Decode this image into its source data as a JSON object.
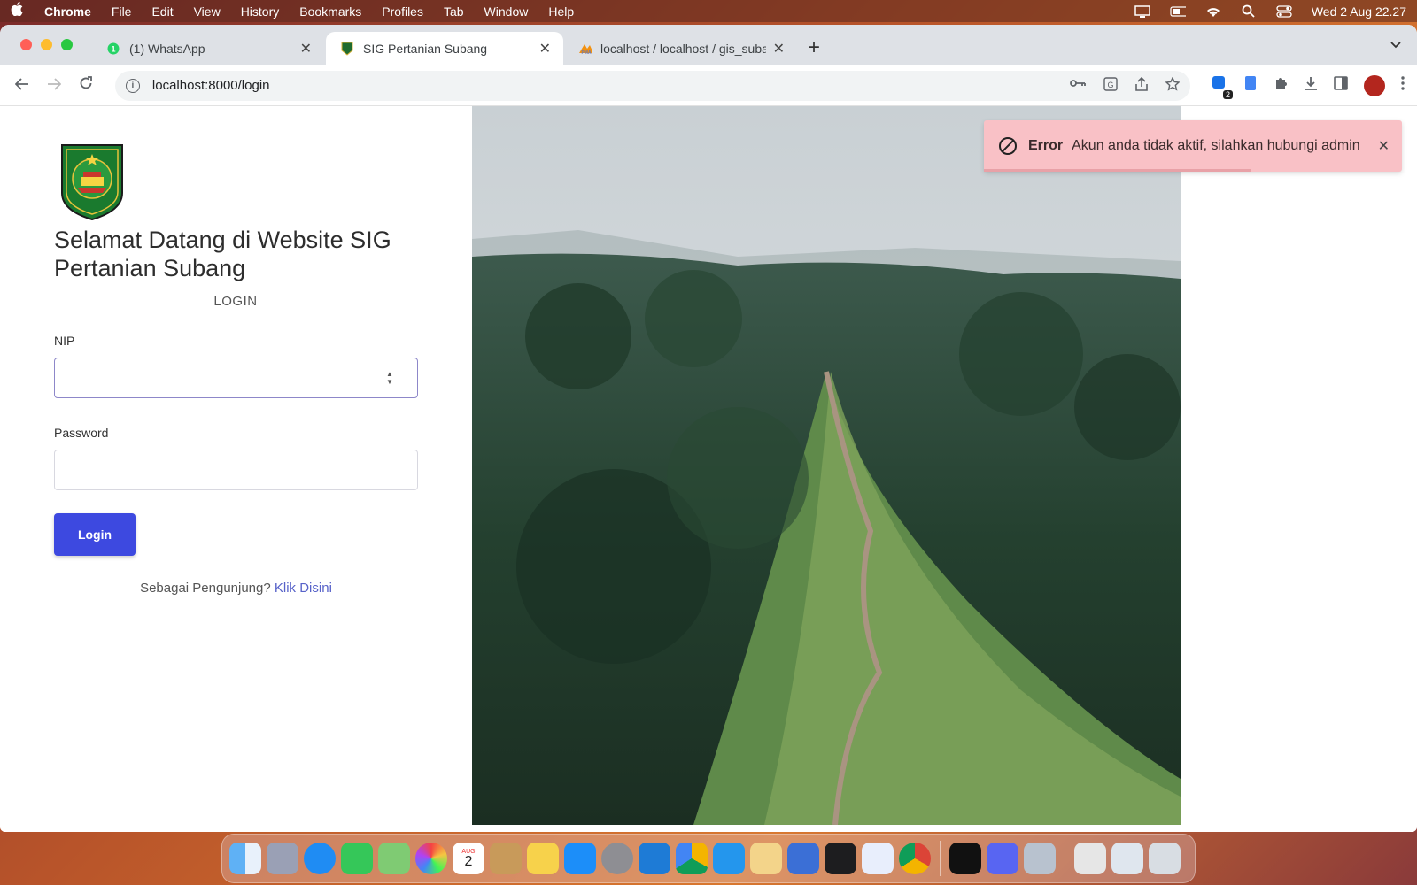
{
  "menubar": {
    "app_name": "Chrome",
    "items": [
      "File",
      "Edit",
      "View",
      "History",
      "Bookmarks",
      "Profiles",
      "Tab",
      "Window",
      "Help"
    ],
    "clock": "Wed 2 Aug  22.27"
  },
  "tabs": [
    {
      "title": "(1) WhatsApp",
      "icon": "whatsapp-icon"
    },
    {
      "title": "SIG Pertanian Subang",
      "icon": "shield-logo-icon"
    },
    {
      "title": "localhost / localhost / gis_suba",
      "icon": "phpmyadmin-icon"
    }
  ],
  "address_bar": {
    "url": "localhost:8000/login"
  },
  "page": {
    "welcome": "Selamat Datang di Website SIG Pertanian Subang",
    "login_title": "LOGIN",
    "nip_label": "NIP",
    "nip_value": "",
    "password_label": "Password",
    "password_value": "",
    "login_button": "Login",
    "visitor_prompt": "Sebagai Pengunjung?",
    "visitor_link": "Klik Disini"
  },
  "toast": {
    "title": "Error",
    "message": "Akun anda tidak aktif, silahkan hubungi admin",
    "progress": 0.64
  },
  "extension_badge": "2",
  "dock_date": {
    "month": "AUG",
    "day": "2"
  },
  "colors": {
    "primary_button": "#3d49e0",
    "link": "#5863c9",
    "toast_bg": "#f9c1c6",
    "toast_progress": "#e8a1a7"
  }
}
